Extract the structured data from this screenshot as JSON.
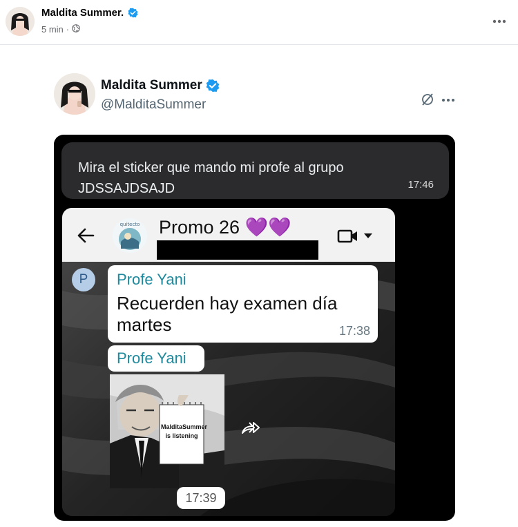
{
  "facebook_post": {
    "author_name": "Maldita Summer.",
    "time": "5 min",
    "separator": "·",
    "audience_icon": "globe-icon",
    "more_icon": "more-horizontal-icon"
  },
  "tweet": {
    "author_name": "Maldita Summer",
    "handle": "@MalditaSummer",
    "verified": true,
    "grok_icon": "grok-icon",
    "more_icon": "more-horizontal-icon"
  },
  "screenshot": {
    "message_text": "Mira el sticker que mando mi profe al grupo JDSSAJDSAJD",
    "message_time": "17:46",
    "chat": {
      "group_name": "Promo 26 💜💜",
      "avatar_caption": "quitecto",
      "messages": [
        {
          "sender_initial": "P",
          "sender": "Profe Yani",
          "text": "Recuerden hay examen día martes",
          "time": "17:38"
        },
        {
          "sender": "Profe Yani",
          "sticker_text": "MalditaSummer is listening",
          "time": "17:39"
        }
      ]
    }
  },
  "colors": {
    "verified_blue": "#1d9bf0",
    "whatsapp_sender": "#1e8a9d"
  }
}
